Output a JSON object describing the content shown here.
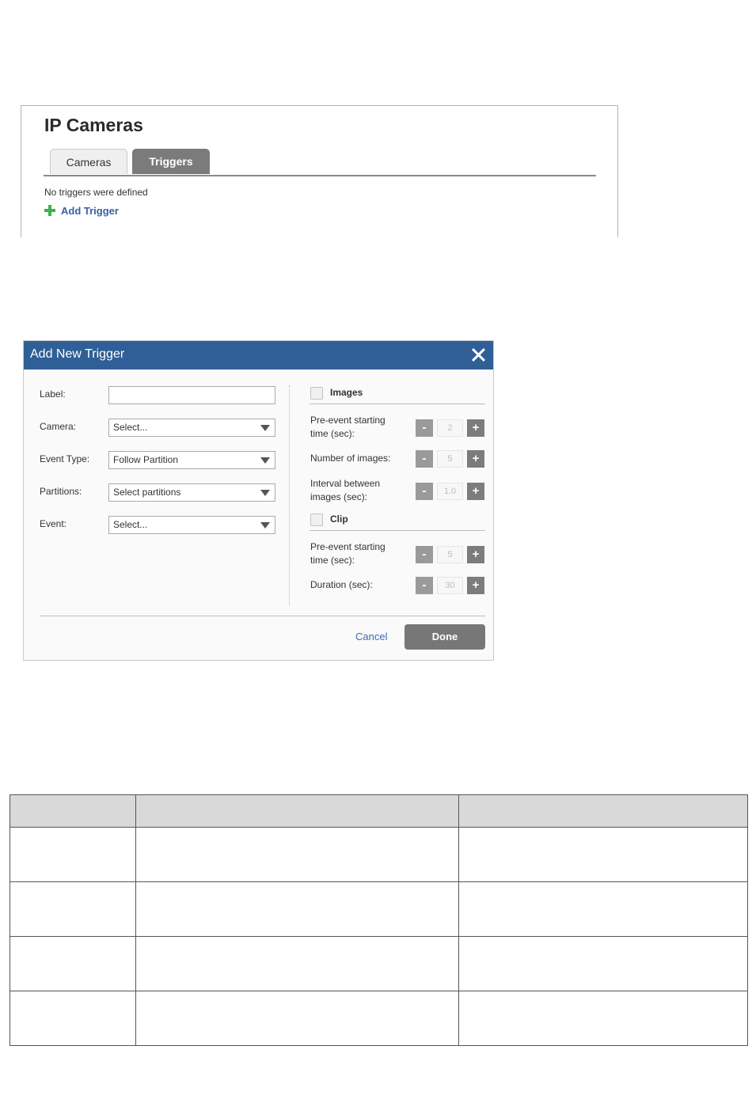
{
  "ip_cameras": {
    "title": "IP Cameras",
    "tabs": [
      {
        "label": "Cameras",
        "active": false
      },
      {
        "label": "Triggers",
        "active": true
      }
    ],
    "empty_message": "No triggers were defined",
    "add_trigger_label": "Add Trigger",
    "colors": {
      "add_icon": "#3db24a",
      "active_tab": "#7b7b7b"
    }
  },
  "dialog": {
    "title": "Add New Trigger",
    "header_color": "#2f5f96",
    "fields": {
      "label": {
        "label": "Label:",
        "value": ""
      },
      "camera": {
        "label": "Camera:",
        "value": "Select..."
      },
      "event_type": {
        "label": "Event Type:",
        "value": "Follow Partition"
      },
      "partitions": {
        "label": "Partitions:",
        "value": "Select partitions"
      },
      "event": {
        "label": "Event:",
        "value": "Select..."
      }
    },
    "images": {
      "label": "Images",
      "checked": false,
      "pre_event": {
        "label": "Pre-event starting time (sec):",
        "value": "2"
      },
      "count": {
        "label": "Number of images:",
        "value": "5"
      },
      "interval": {
        "label": "Interval between images (sec):",
        "value": "1.0"
      }
    },
    "clip": {
      "label": "Clip",
      "checked": false,
      "pre_event": {
        "label": "Pre-event starting time (sec):",
        "value": "5"
      },
      "duration": {
        "label": "Duration (sec):",
        "value": "30"
      }
    },
    "stepper_minus": "-",
    "stepper_plus": "+",
    "cancel_label": "Cancel",
    "done_label": "Done"
  },
  "table": {
    "header": [
      "",
      "",
      ""
    ],
    "rows": [
      [
        "",
        "",
        ""
      ],
      [
        "",
        "",
        ""
      ],
      [
        "",
        "",
        ""
      ],
      [
        "",
        "",
        ""
      ]
    ]
  }
}
